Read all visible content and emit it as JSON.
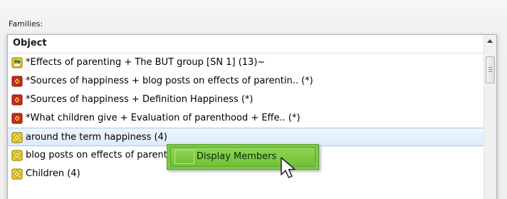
{
  "section_label": "Families:",
  "column_header": "Object",
  "rows": [
    {
      "text": "*Effects of parenting + The BUT group [SN 1] (13)~",
      "icon": "family-group-icon"
    },
    {
      "text": "*Sources of happiness + blog posts on effects of parentin.. (*)",
      "icon": "red-code-family-icon"
    },
    {
      "text": "*Sources of happiness + Definition Happiness (*)",
      "icon": "red-code-family-icon"
    },
    {
      "text": "*What children give + Evaluation of parenthood + Effe.. (*)",
      "icon": "red-code-family-icon"
    },
    {
      "text": "around the term happiness (4)",
      "icon": "yellow-code-family-icon"
    },
    {
      "text": "blog posts on effects of parenting (4)",
      "icon": "yellow-code-family-icon"
    },
    {
      "text": "Children (4)",
      "icon": "yellow-code-family-icon"
    }
  ],
  "selected_row_index": 4,
  "context_menu": {
    "items": [
      {
        "label": "Display Members"
      }
    ]
  },
  "colors": {
    "menu_green": "#7dc943",
    "selection_blue": "#dcebfb",
    "icon_yellow": "#f2d21b",
    "icon_red": "#d9261c"
  }
}
